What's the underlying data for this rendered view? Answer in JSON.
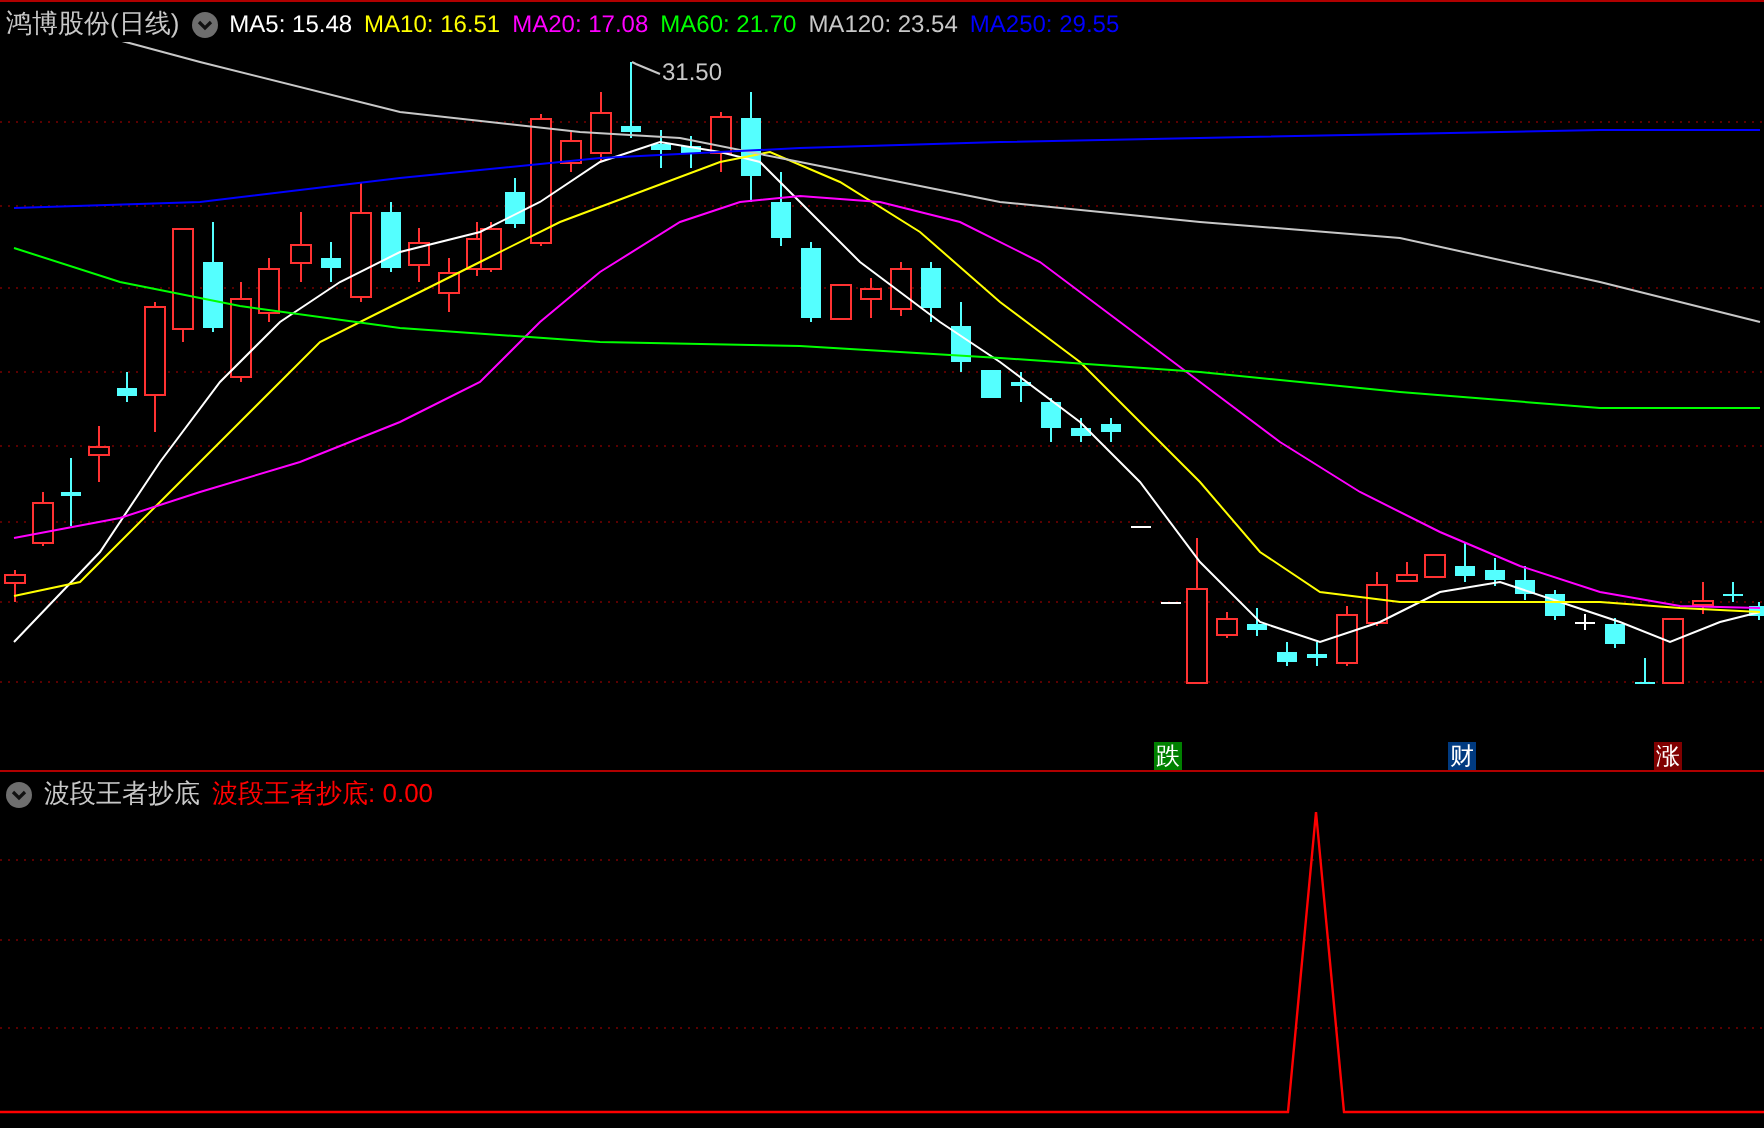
{
  "main_chart": {
    "title": "鸿博股份(日线)",
    "legend": [
      {
        "label": "MA5: 15.48",
        "color": "#ffffff"
      },
      {
        "label": "MA10: 16.51",
        "color": "#ffff00"
      },
      {
        "label": "MA20: 17.08",
        "color": "#ff00ff"
      },
      {
        "label": "MA60: 21.70",
        "color": "#00ff00"
      },
      {
        "label": "MA120: 23.54",
        "color": "#c8c8c8"
      },
      {
        "label": "MA250: 29.55",
        "color": "#0000ff"
      }
    ],
    "high_marker": "31.50",
    "signals": [
      {
        "label": "跌",
        "color": "#008000"
      },
      {
        "label": "财",
        "color": "#003a80"
      },
      {
        "label": "涨",
        "color": "#800000"
      }
    ]
  },
  "indicator_panel": {
    "title": "波段王者抄底",
    "reading": "波段王者抄底: 0.00"
  }
}
